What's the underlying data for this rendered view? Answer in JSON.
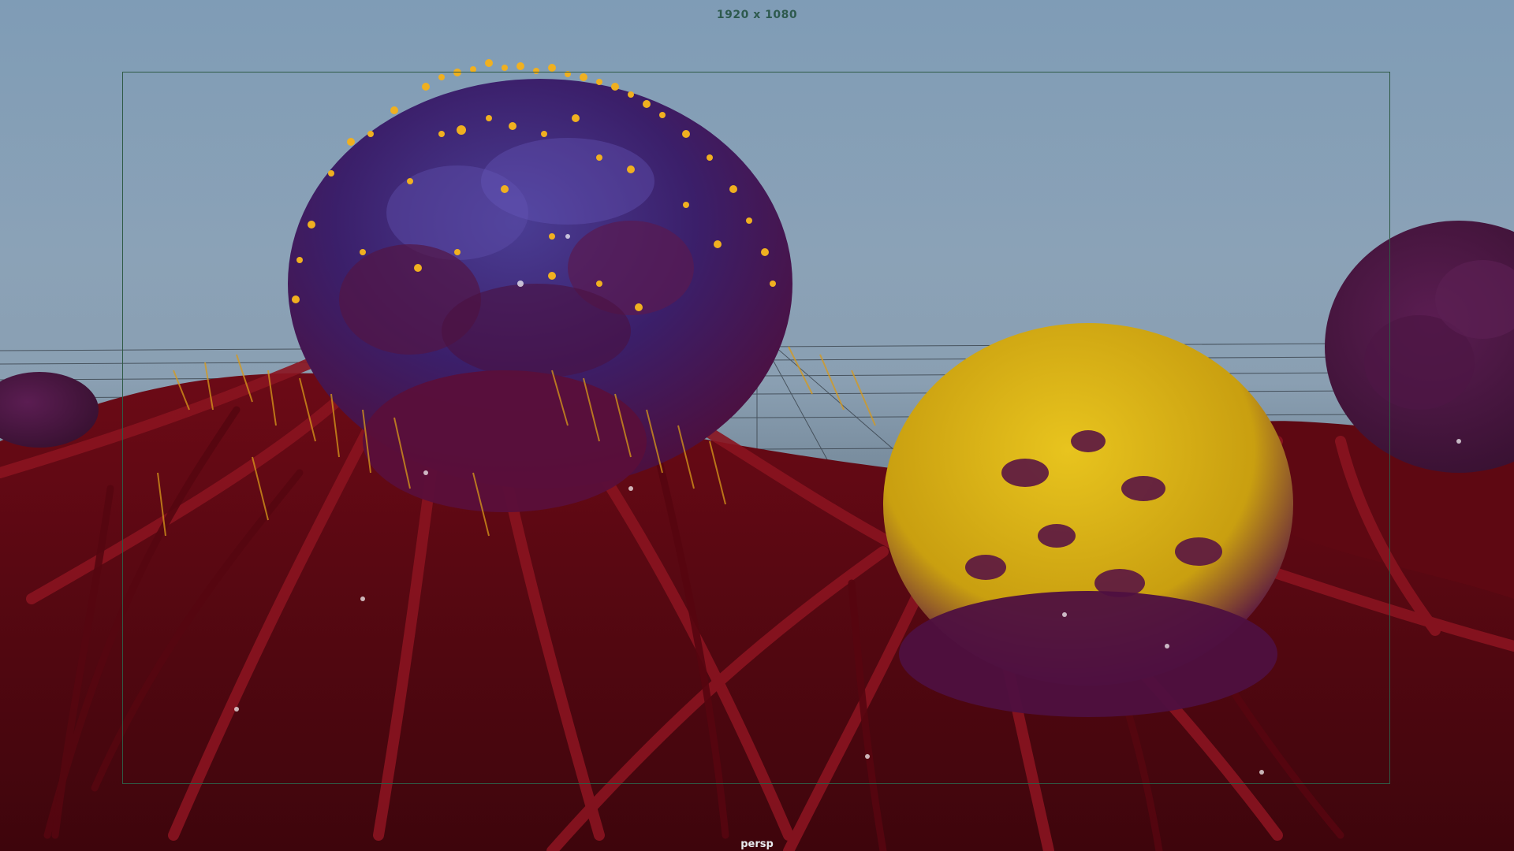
{
  "viewport": {
    "resolution_label": "1920 x 1080",
    "camera_label": "persp"
  },
  "scene": {
    "objects": [
      {
        "name": "large-blue-tumor",
        "color": "#3a2a78"
      },
      {
        "name": "yellow-tumor",
        "color": "#d8b312"
      },
      {
        "name": "purple-tumor-right",
        "color": "#4a1540"
      },
      {
        "name": "small-purple-tumor-left",
        "color": "#5a1848"
      },
      {
        "name": "blood-vessels",
        "color": "#6e0c14"
      },
      {
        "name": "yellow-particles",
        "color": "#f0b020"
      }
    ],
    "background_color": "#8ba2b7",
    "grid_color": "#3c4650"
  }
}
